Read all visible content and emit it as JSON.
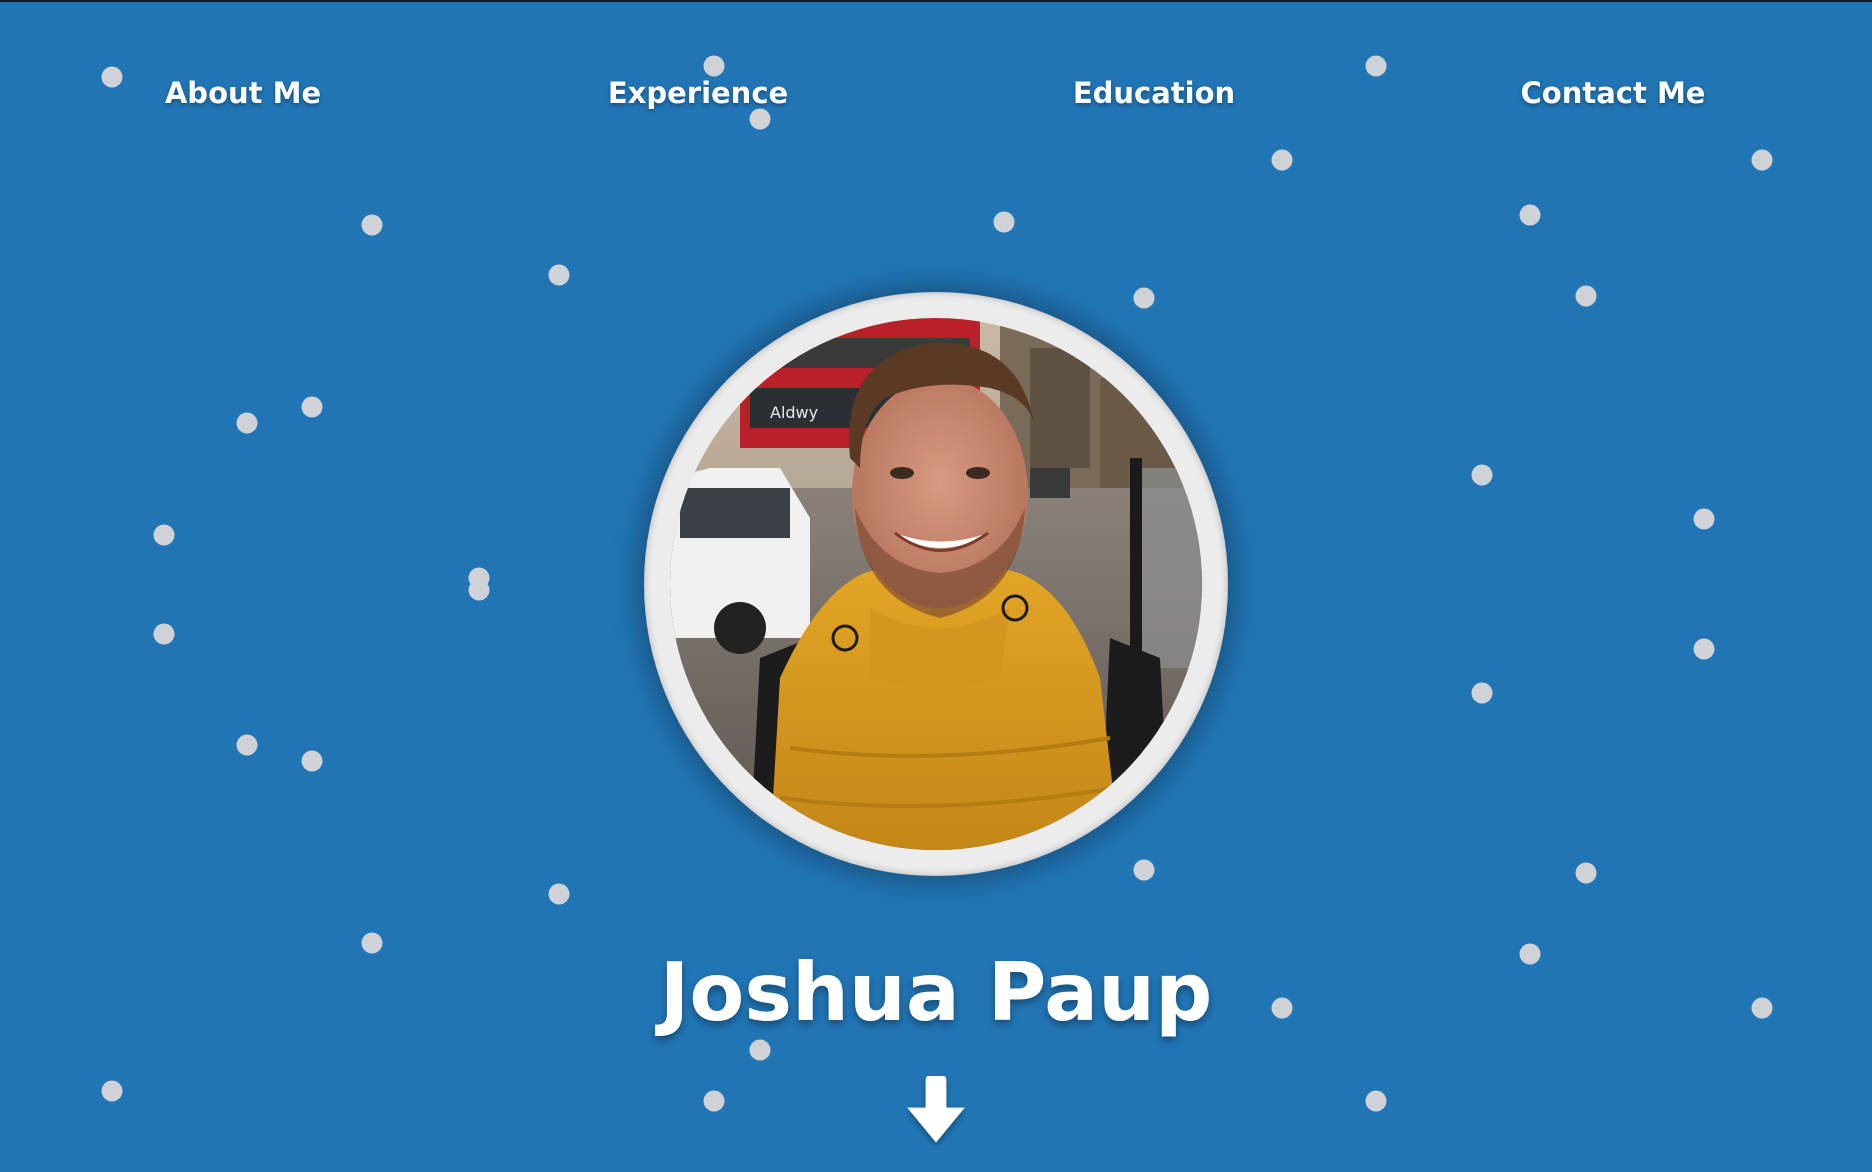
{
  "nav": {
    "items": [
      {
        "label": "About Me"
      },
      {
        "label": "Experience"
      },
      {
        "label": "Education"
      },
      {
        "label": "Contact Me"
      }
    ]
  },
  "profile": {
    "name": "Joshua Paup",
    "photo_sign_text": "Aldwy"
  },
  "icons": {
    "scroll": "arrow-down-icon"
  },
  "colors": {
    "background": "#2175b5",
    "dot": "#cfd2d6",
    "text": "#ffffff"
  }
}
